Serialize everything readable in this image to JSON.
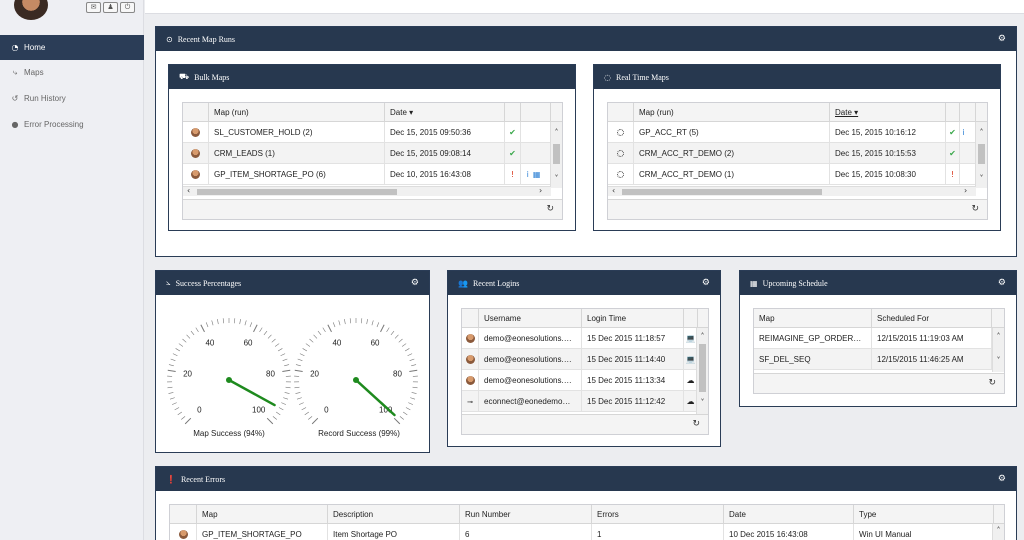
{
  "sidebar": {
    "header_buttons": [
      {
        "icon": "envelope-icon",
        "glyph": "✉"
      },
      {
        "icon": "user-icon",
        "glyph": "♟"
      },
      {
        "icon": "power-icon",
        "glyph": "⏻"
      }
    ],
    "items": [
      {
        "label": "Home",
        "icon": "dashboard-icon",
        "glyph": "◔",
        "active": true
      },
      {
        "label": "Maps",
        "icon": "maps-icon",
        "glyph": "⤷",
        "active": false
      },
      {
        "label": "Run History",
        "icon": "history-icon",
        "glyph": "↺",
        "active": false
      },
      {
        "label": "Error Processing",
        "icon": "error-icon",
        "glyph": "●",
        "active": false
      }
    ]
  },
  "recent_map_runs": {
    "title": "Recent Map Runs",
    "bulk": {
      "title": "Bulk Maps",
      "columns": [
        "",
        "Map (run)",
        "Date ▾",
        "",
        ""
      ],
      "rows": [
        {
          "map": "SL_CUSTOMER_HOLD (2)",
          "date": "Dec 15, 2015 09:50:36",
          "status": "✔",
          "status_type": "ok",
          "extra": [
            "",
            ""
          ]
        },
        {
          "map": "CRM_LEADS (1)",
          "date": "Dec 15, 2015 09:08:14",
          "status": "✔",
          "status_type": "ok",
          "extra": [
            "",
            ""
          ]
        },
        {
          "map": "GP_ITEM_SHORTAGE_PO (6)",
          "date": "Dec 10, 2015 16:43:08",
          "status": "!",
          "status_type": "err",
          "extra": [
            "i",
            "▦"
          ]
        }
      ]
    },
    "realtime": {
      "title": "Real Time Maps",
      "columns": [
        "",
        "Map (run)",
        "Date ▾",
        "",
        ""
      ],
      "rows": [
        {
          "map": "GP_ACC_RT (5)",
          "date": "Dec 15, 2015 10:16:12",
          "status": "✔",
          "status_type": "ok",
          "extra": [
            "i",
            ""
          ]
        },
        {
          "map": "CRM_ACC_RT_DEMO (2)",
          "date": "Dec 15, 2015 10:15:53",
          "status": "✔",
          "status_type": "ok",
          "extra": [
            "",
            ""
          ]
        },
        {
          "map": "CRM_ACC_RT_DEMO (1)",
          "date": "Dec 15, 2015 10:08:30",
          "status": "!",
          "status_type": "err",
          "extra": [
            "",
            ""
          ]
        }
      ]
    }
  },
  "success": {
    "title": "Success Percentages",
    "gauges": [
      {
        "label": "Map Success (94%)",
        "value": 94,
        "ticks": [
          "0",
          "20",
          "40",
          "60",
          "80",
          "100"
        ]
      },
      {
        "label": "Record Success (99%)",
        "value": 99,
        "ticks": [
          "0",
          "20",
          "40",
          "60",
          "80",
          "100"
        ]
      }
    ]
  },
  "logins": {
    "title": "Recent Logins",
    "columns": [
      "",
      "Username",
      "Login Time",
      ""
    ],
    "rows": [
      {
        "username": "demo@eonesolutions.…",
        "time": "15 Dec 2015 11:18:57",
        "device": "💻"
      },
      {
        "username": "demo@eonesolutions.…",
        "time": "15 Dec 2015 11:14:40",
        "device": "💻"
      },
      {
        "username": "demo@eonesolutions.…",
        "time": "15 Dec 2015 11:13:34",
        "device": "☁"
      },
      {
        "username": "econnect@eonedemo…",
        "time": "15 Dec 2015 11:12:42",
        "device": "☁"
      }
    ]
  },
  "schedule": {
    "title": "Upcoming Schedule",
    "columns": [
      "Map",
      "Scheduled For"
    ],
    "rows": [
      {
        "map": "REIMAGINE_GP_ORDER…",
        "time": "12/15/2015 11:19:03 AM"
      },
      {
        "map": "SF_DEL_SEQ",
        "time": "12/15/2015 11:46:25 AM"
      }
    ]
  },
  "errors": {
    "title": "Recent Errors",
    "columns": [
      "",
      "Map",
      "Description",
      "Run Number",
      "Errors",
      "Date",
      "Type"
    ],
    "rows": [
      {
        "map": "GP_ITEM_SHORTAGE_PO",
        "description": "Item Shortage PO",
        "run": "6",
        "errors": "1",
        "date": "10 Dec 2015 16:43:08",
        "type": "Win UI Manual"
      }
    ]
  },
  "colors": {
    "header": "#27384f",
    "ok": "#3aa84b",
    "error": "#d9381e",
    "needle": "#1e8a1e"
  }
}
